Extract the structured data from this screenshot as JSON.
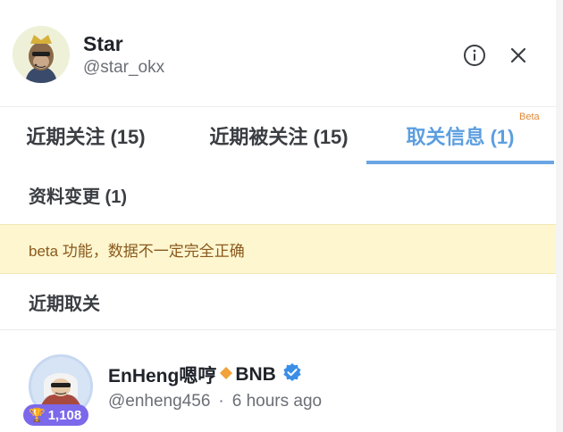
{
  "profile": {
    "name": "Star",
    "handle": "@star_okx",
    "avatar_icon": "ape-avatar-icon"
  },
  "header_actions": {
    "info_icon": "info-icon",
    "close_icon": "close-icon"
  },
  "tabs": [
    {
      "label": "近期关注 (15)",
      "active": false
    },
    {
      "label": "近期被关注 (15)",
      "active": false
    },
    {
      "label": "取关信息 (1)",
      "active": true
    }
  ],
  "beta_tag": "Beta",
  "sections": {
    "profile_changes": "资料变更 (1)",
    "notice": "beta 功能，数据不一定完全正确",
    "recent_unfollows": "近期取关"
  },
  "users": [
    {
      "name": "EnHeng嗯哼",
      "token_label": "BNB",
      "handle": "@enheng456",
      "time_ago": "6 hours ago",
      "trophy_count": "1,108",
      "verified": true
    }
  ],
  "colors": {
    "accent_blue": "#5b9ee0",
    "notice_bg": "#fdf6cf",
    "notice_text": "#8a5a1e",
    "beta_orange": "#e08a3a",
    "badge_purple": "#7c68ea",
    "verified_blue": "#3b8ee8",
    "diamond_orange": "#f0a23b"
  }
}
